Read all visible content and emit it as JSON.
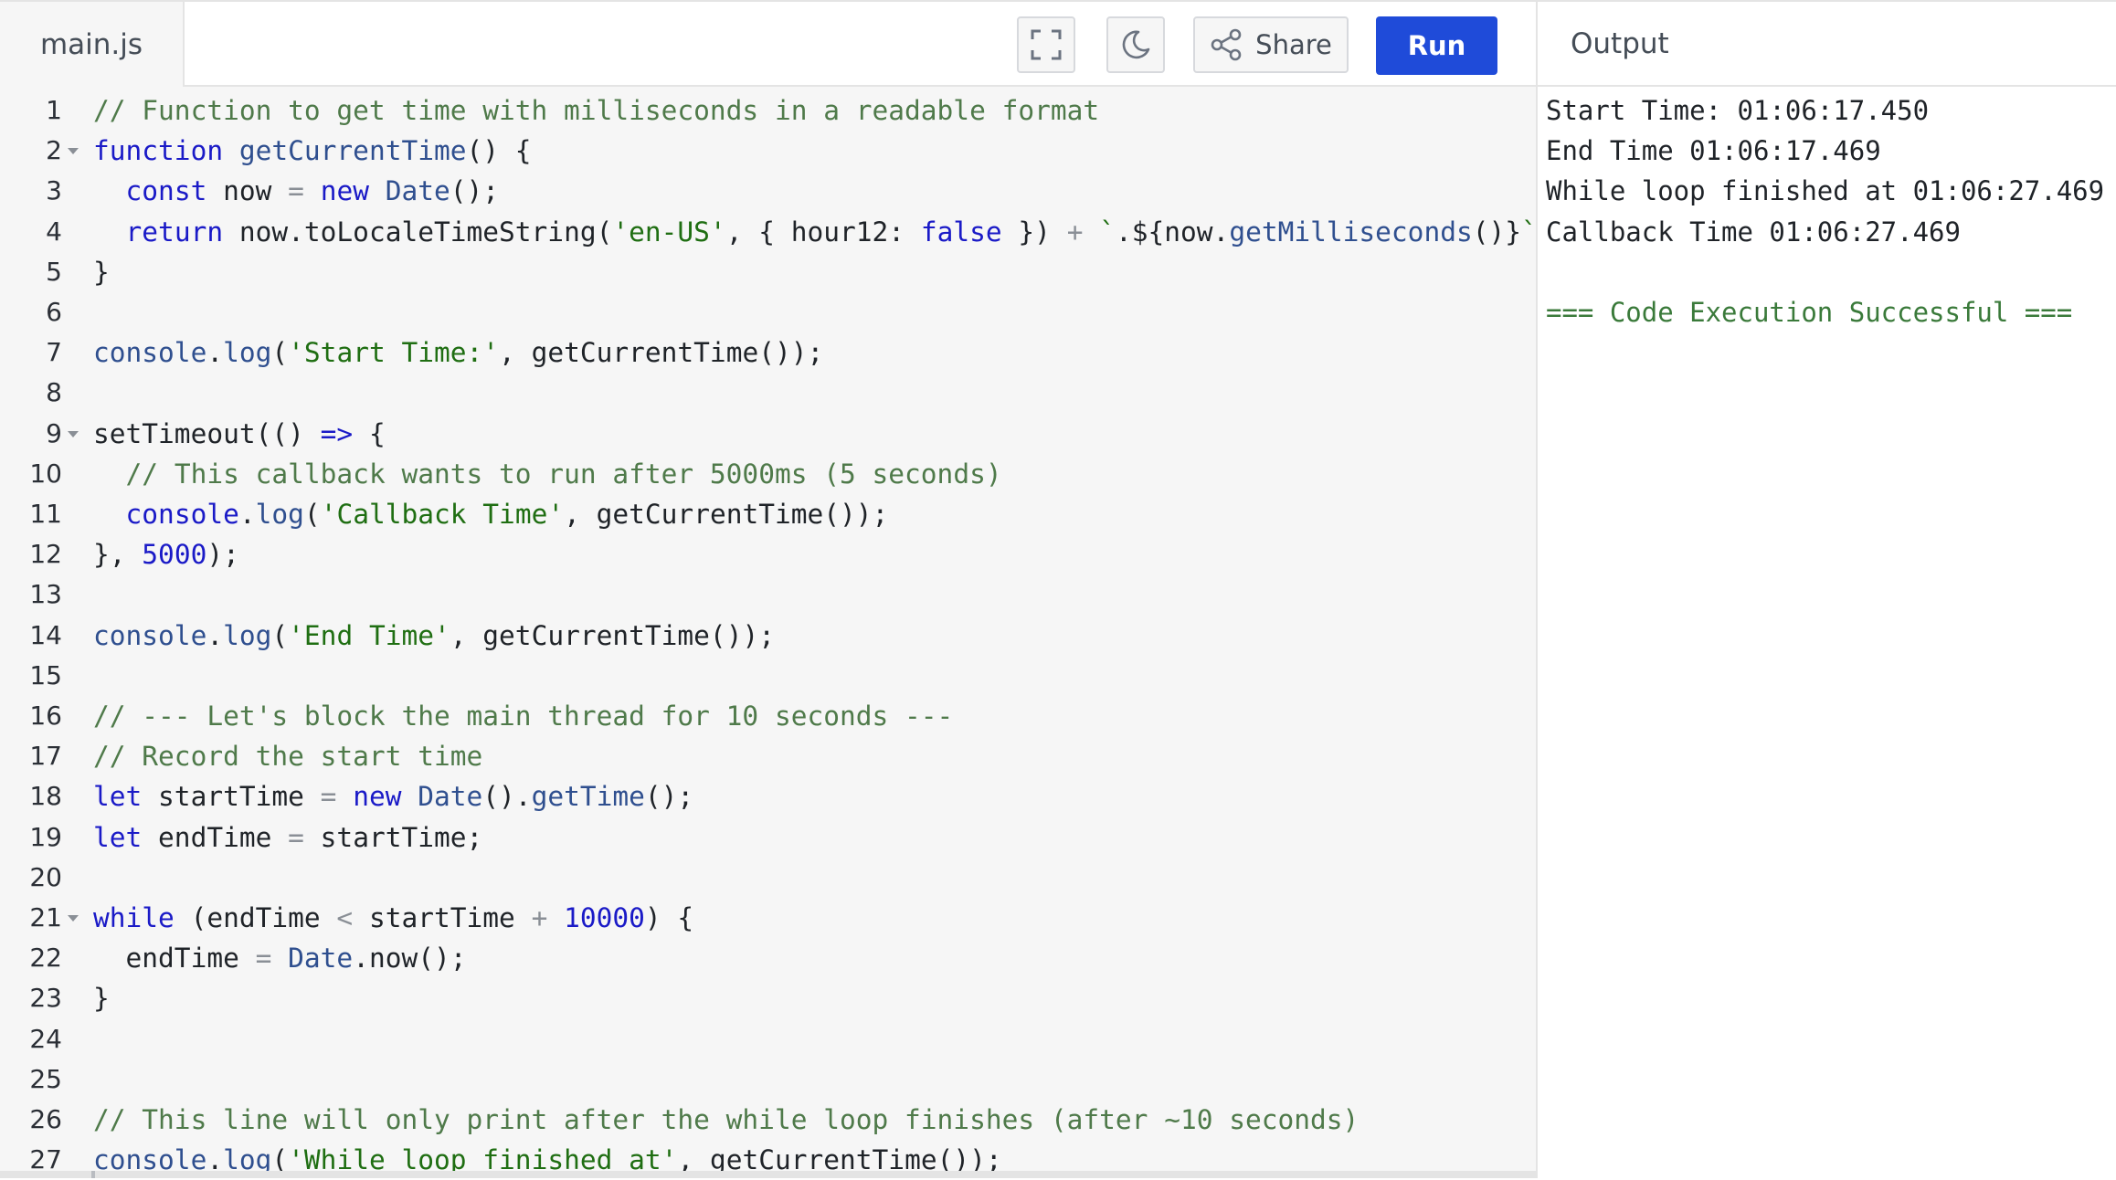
{
  "editor": {
    "file_tab": "main.js",
    "toolbar": {
      "fullscreen_icon": "fullscreen-icon",
      "theme_icon": "moon-icon",
      "share_icon": "share-icon",
      "share_label": "Share",
      "run_label": "Run"
    },
    "line_numbers": [
      "1",
      "2",
      "3",
      "4",
      "5",
      "6",
      "7",
      "8",
      "9",
      "10",
      "11",
      "12",
      "13",
      "14",
      "15",
      "16",
      "17",
      "18",
      "19",
      "20",
      "21",
      "22",
      "23",
      "24",
      "25",
      "26",
      "27"
    ],
    "fold_lines": [
      2,
      9,
      21
    ],
    "lines": [
      [
        [
          "comment",
          "// Function to get time with milliseconds in a readable format"
        ]
      ],
      [
        [
          "keyword",
          "function "
        ],
        [
          "builtin",
          "getCurrentTime"
        ],
        [
          "plain",
          "() {"
        ]
      ],
      [
        [
          "plain",
          "  "
        ],
        [
          "keyword",
          "const "
        ],
        [
          "plain",
          "now "
        ],
        [
          "operator",
          "= "
        ],
        [
          "keyword",
          "new "
        ],
        [
          "builtin",
          "Date"
        ],
        [
          "plain",
          "();"
        ]
      ],
      [
        [
          "plain",
          "  "
        ],
        [
          "keyword",
          "return "
        ],
        [
          "plain",
          "now.toLocaleTimeString("
        ],
        [
          "string",
          "'en-US'"
        ],
        [
          "plain",
          ", { hour12: "
        ],
        [
          "keyword",
          "false"
        ],
        [
          "plain",
          " }) "
        ],
        [
          "operator",
          "+ "
        ],
        [
          "string",
          "`"
        ],
        [
          "plain",
          ".${now."
        ],
        [
          "builtin",
          "getMilliseconds"
        ],
        [
          "plain",
          "()}"
        ],
        [
          "string",
          "`"
        ],
        [
          "plain",
          ";"
        ]
      ],
      [
        [
          "plain",
          "}"
        ]
      ],
      [],
      [
        [
          "builtin",
          "console"
        ],
        [
          "plain",
          "."
        ],
        [
          "builtin",
          "log"
        ],
        [
          "plain",
          "("
        ],
        [
          "string",
          "'Start Time:'"
        ],
        [
          "plain",
          ", getCurrentTime());"
        ]
      ],
      [],
      [
        [
          "plain",
          "setTimeout(() "
        ],
        [
          "keyword",
          "=>"
        ],
        [
          "plain",
          " {"
        ]
      ],
      [
        [
          "plain",
          "  "
        ],
        [
          "comment",
          "// This callback wants to run after 5000ms (5 seconds)"
        ]
      ],
      [
        [
          "plain",
          "  "
        ],
        [
          "keyword",
          "console"
        ],
        [
          "plain",
          "."
        ],
        [
          "builtin",
          "log"
        ],
        [
          "plain",
          "("
        ],
        [
          "string",
          "'Callback Time'"
        ],
        [
          "plain",
          ", getCurrentTime());"
        ]
      ],
      [
        [
          "plain",
          "}, "
        ],
        [
          "number",
          "5000"
        ],
        [
          "plain",
          ");"
        ]
      ],
      [],
      [
        [
          "builtin",
          "console"
        ],
        [
          "plain",
          "."
        ],
        [
          "builtin",
          "log"
        ],
        [
          "plain",
          "("
        ],
        [
          "string",
          "'End Time'"
        ],
        [
          "plain",
          ", getCurrentTime());"
        ]
      ],
      [],
      [
        [
          "comment",
          "// --- Let's block the main thread for 10 seconds ---"
        ]
      ],
      [
        [
          "comment",
          "// Record the start time"
        ]
      ],
      [
        [
          "keyword",
          "let "
        ],
        [
          "plain",
          "startTime "
        ],
        [
          "operator",
          "= "
        ],
        [
          "keyword",
          "new "
        ],
        [
          "builtin",
          "Date"
        ],
        [
          "plain",
          "()."
        ],
        [
          "builtin",
          "getTime"
        ],
        [
          "plain",
          "();"
        ]
      ],
      [
        [
          "keyword",
          "let "
        ],
        [
          "plain",
          "endTime "
        ],
        [
          "operator",
          "= "
        ],
        [
          "plain",
          "startTime;"
        ]
      ],
      [],
      [
        [
          "keyword",
          "while"
        ],
        [
          "plain",
          " (endTime "
        ],
        [
          "operator",
          "< "
        ],
        [
          "plain",
          "startTime "
        ],
        [
          "operator",
          "+ "
        ],
        [
          "number",
          "10000"
        ],
        [
          "plain",
          ") {"
        ]
      ],
      [
        [
          "plain",
          "  endTime "
        ],
        [
          "operator",
          "= "
        ],
        [
          "builtin",
          "Date"
        ],
        [
          "plain",
          ".now();"
        ]
      ],
      [
        [
          "plain",
          "}"
        ]
      ],
      [],
      [],
      [
        [
          "comment",
          "// This line will only print after the while loop finishes (after ~10 seconds)"
        ]
      ],
      [
        [
          "builtin",
          "console"
        ],
        [
          "plain",
          "."
        ],
        [
          "builtin",
          "log"
        ],
        [
          "plain",
          "("
        ],
        [
          "string",
          "'While loop finished at'"
        ],
        [
          "plain",
          ", getCurrentTime());"
        ]
      ]
    ]
  },
  "output": {
    "title": "Output",
    "lines": [
      "Start Time: 01:06:17.450",
      "End Time 01:06:17.469",
      "While loop finished at 01:06:27.469",
      "Callback Time 01:06:27.469",
      "",
      "=== Code Execution Successful ==="
    ],
    "success_index": 5
  }
}
